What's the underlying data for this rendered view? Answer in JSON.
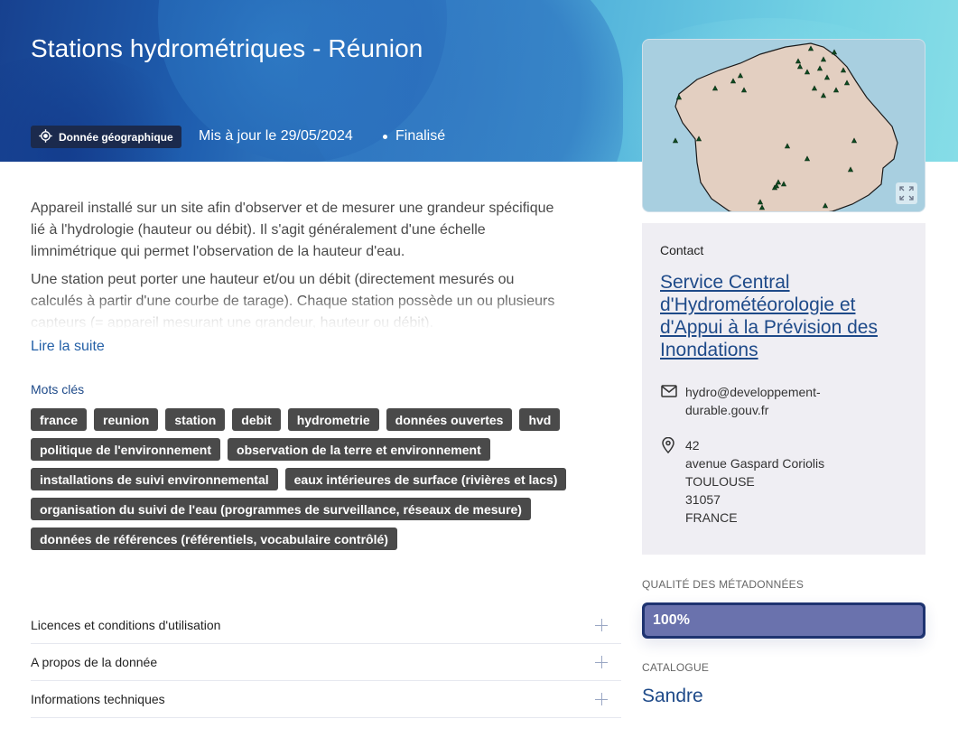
{
  "header": {
    "title": "Stations hydrométriques - Réunion",
    "badge_label": "Donnée géographique",
    "update_text": "Mis à jour le 29/05/2024",
    "status_text": "Finalisé"
  },
  "description": {
    "paragraphs": [
      "Appareil installé sur un site afin d'observer et de mesurer une grandeur spécifique lié à l'hydrologie (hauteur ou débit). Il s'agit généralement d'une échelle limnimétrique qui permet l'observation de la hauteur d'eau.",
      "Une station peut porter une hauteur et/ou un débit (directement mesurés ou calculés à partir d'une courbe de tarage). Chaque station possède un ou plusieurs capteurs (= appareil mesurant une grandeur, hauteur ou débit)."
    ],
    "read_more_label": "Lire la suite"
  },
  "keywords": {
    "title": "Mots clés",
    "items": [
      "france",
      "reunion",
      "station",
      "debit",
      "hydrometrie",
      "données ouvertes",
      "hvd",
      "politique de l'environnement",
      "observation de la terre et environnement",
      "installations de suivi environnemental",
      "eaux intérieures de surface (rivières et lacs)",
      "organisation du suivi de l'eau (programmes de surveillance, réseaux de mesure)",
      "données de références (référentiels, vocabulaire contrôlé)"
    ]
  },
  "accordion": {
    "items": [
      "Licences et conditions d'utilisation",
      "A propos de la donnée",
      "Informations techniques"
    ]
  },
  "map": {
    "colors": {
      "sea": "#a8cfe0",
      "land": "#e3cfc1",
      "marker": "#0f4d22"
    }
  },
  "contact": {
    "label": "Contact",
    "organization": "Service Central d'Hydrométéorologie et d'Appui à la Prévision des Inondations",
    "email_line1": "hydro@developpement-",
    "email_line2": "durable.gouv.fr",
    "address": [
      "42",
      "avenue Gaspard Coriolis",
      "TOULOUSE",
      "31057",
      "FRANCE"
    ]
  },
  "quality": {
    "label": "QUALITÉ DES MÉTADONNÉES",
    "value_text": "100%",
    "value": 1.0
  },
  "catalog": {
    "label": "CATALOGUE",
    "value": "Sandre"
  }
}
